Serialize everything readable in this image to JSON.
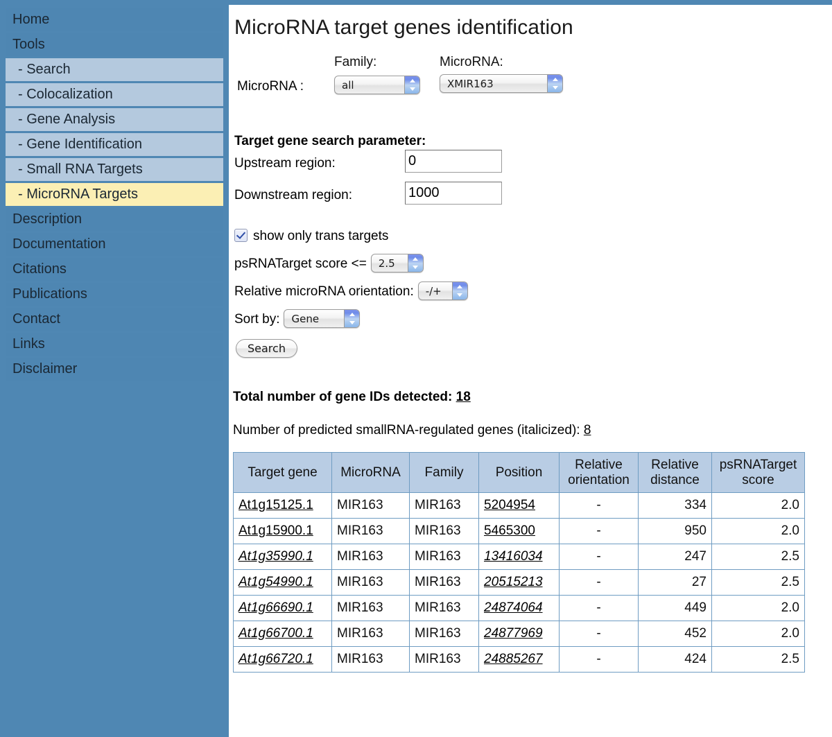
{
  "sidebar": {
    "items": [
      {
        "label": "Home",
        "type": "top"
      },
      {
        "label": "Tools",
        "type": "top"
      },
      {
        "label": "- Search",
        "type": "sub"
      },
      {
        "label": "- Colocalization",
        "type": "sub"
      },
      {
        "label": "- Gene Analysis",
        "type": "sub"
      },
      {
        "label": "- Gene Identification",
        "type": "sub"
      },
      {
        "label": "- Small RNA Targets",
        "type": "sub"
      },
      {
        "label": "- MicroRNA Targets",
        "type": "sub",
        "active": true
      },
      {
        "label": "Description",
        "type": "top"
      },
      {
        "label": "Documentation",
        "type": "top"
      },
      {
        "label": "Citations",
        "type": "top"
      },
      {
        "label": "Publications",
        "type": "top"
      },
      {
        "label": "Contact",
        "type": "top"
      },
      {
        "label": "Links",
        "type": "top"
      },
      {
        "label": "Disclaimer",
        "type": "top"
      }
    ],
    "background_color": "#4f87b3",
    "sub_background_color": "#b4c9de",
    "active_background_color": "#fbefb4"
  },
  "header": {
    "title": "MicroRNA target genes identification"
  },
  "selector": {
    "row_label": "MicroRNA :",
    "family_label": "Family:",
    "microrna_label": "MicroRNA:",
    "family_value": "all",
    "microrna_value": "XMIR163"
  },
  "params": {
    "heading": "Target gene search parameter:",
    "upstream_label": "Upstream region:",
    "upstream_value": "0",
    "downstream_label": "Downstream region:",
    "downstream_value": "1000"
  },
  "options": {
    "trans_label": "show only trans targets",
    "trans_checked": true,
    "score_label": "psRNATarget score <=",
    "score_value": "2.5",
    "orientation_label": "Relative microRNA orientation:",
    "orientation_value": "-/+",
    "sort_label": "Sort by:",
    "sort_value": "Gene",
    "search_button": "Search"
  },
  "results": {
    "total_label": "Total number of gene IDs detected:",
    "total_value": "18",
    "predicted_label": "Number of predicted smallRNA-regulated genes (italicized):",
    "predicted_value": "8",
    "columns": [
      "Target gene",
      "MicroRNA",
      "Family",
      "Position",
      "Relative orientation",
      "Relative distance",
      "psRNATarget score"
    ],
    "rows": [
      {
        "gene": "At1g15125.1",
        "microrna": "MIR163",
        "family": "MIR163",
        "position": "5204954",
        "orientation": "-",
        "distance": "334",
        "score": "2.0",
        "italic": false
      },
      {
        "gene": "At1g15900.1",
        "microrna": "MIR163",
        "family": "MIR163",
        "position": "5465300",
        "orientation": "-",
        "distance": "950",
        "score": "2.0",
        "italic": false
      },
      {
        "gene": "At1g35990.1",
        "microrna": "MIR163",
        "family": "MIR163",
        "position": "13416034",
        "orientation": "-",
        "distance": "247",
        "score": "2.5",
        "italic": true
      },
      {
        "gene": "At1g54990.1",
        "microrna": "MIR163",
        "family": "MIR163",
        "position": "20515213",
        "orientation": "-",
        "distance": "27",
        "score": "2.5",
        "italic": true
      },
      {
        "gene": "At1g66690.1",
        "microrna": "MIR163",
        "family": "MIR163",
        "position": "24874064",
        "orientation": "-",
        "distance": "449",
        "score": "2.0",
        "italic": true
      },
      {
        "gene": "At1g66700.1",
        "microrna": "MIR163",
        "family": "MIR163",
        "position": "24877969",
        "orientation": "-",
        "distance": "452",
        "score": "2.0",
        "italic": true
      },
      {
        "gene": "At1g66720.1",
        "microrna": "MIR163",
        "family": "MIR163",
        "position": "24885267",
        "orientation": "-",
        "distance": "424",
        "score": "2.5",
        "italic": true
      }
    ]
  }
}
